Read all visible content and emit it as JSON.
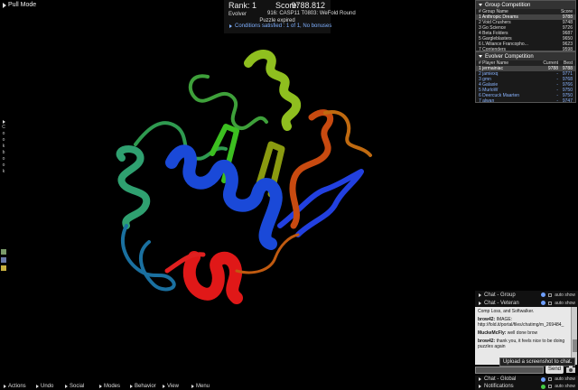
{
  "pull_mode": {
    "label": "Pull Mode"
  },
  "score_panel": {
    "rank": "Rank: 1",
    "score_label": "Score:",
    "score_value": "9788.812",
    "player": "Evolver",
    "puzzle": "916: CASP11 T0803: WeFold Round",
    "status": "Puzzle expired",
    "conditions": "Conditions satisfied : 1 of 1, No bonuses"
  },
  "cookbook": {
    "letters": [
      "C",
      "o",
      "o",
      "k",
      "b",
      "o",
      "o",
      "k"
    ]
  },
  "group_competition": {
    "title": "Group Competition",
    "col_name": "# Group Name",
    "col_score": "Score",
    "rows": [
      {
        "name": "1 Anthropic Dreams",
        "score": "9788",
        "highlight": true
      },
      {
        "name": "2 Void Crushers",
        "score": "9748"
      },
      {
        "name": "3 Go Science",
        "score": "9726"
      },
      {
        "name": "4 Beta Folders",
        "score": "9687"
      },
      {
        "name": "5 Gargleblasters",
        "score": "9650"
      },
      {
        "name": "6 L'Alliance Francopho...",
        "score": "9623"
      },
      {
        "name": "7 Contenders",
        "score": "9598"
      }
    ]
  },
  "evolver_competition": {
    "title": "Evolver Competition",
    "col_name": "# Player Name",
    "col_current": "Current",
    "col_best": "Best",
    "rows": [
      {
        "name": "1 jermainiac",
        "current": "9788",
        "best": "9788",
        "highlight": true
      },
      {
        "name": "2 jamiexq",
        "current": "-",
        "best": "9771",
        "blue": true
      },
      {
        "name": "3 gmn",
        "current": "-",
        "best": "9768",
        "blue": true
      },
      {
        "name": "4 Galaxie",
        "current": "-",
        "best": "9766",
        "blue": true
      },
      {
        "name": "5 MurloW",
        "current": "-",
        "best": "9750",
        "blue": true
      },
      {
        "name": "6 Deercuck Maarten",
        "current": "-",
        "best": "9750",
        "blue": true
      },
      {
        "name": "7 alwan",
        "current": "-",
        "best": "9747",
        "blue": true
      }
    ]
  },
  "chat": {
    "tab_group": "Chat - Group",
    "tab_veteran": "Chat - Veteran",
    "auto_show": "auto show",
    "messages": [
      {
        "who": "",
        "text": "Comp Loss, and Softwalker."
      },
      {
        "who": "brow42:",
        "text": "IMAGE: http://fold.it/portal/files/chatimg/m_269484_"
      },
      {
        "who": "MuckeMcFly:",
        "text": "well done brow"
      },
      {
        "who": "brow42:",
        "text": "thank you, it feels nice to be doing puzzles again"
      }
    ],
    "tooltip": "Upload a screenshot to chat.",
    "send": "Send",
    "tab_global": "Chat - Global",
    "tab_notifications": "Notifications"
  },
  "menu": [
    "Actions",
    "Undo",
    "Social",
    "Modes",
    "Behavior",
    "View",
    "Menu"
  ],
  "colors": {
    "panel_bg": "#1a1a1a",
    "highlight": "#444444",
    "link_blue": "#8ab4ff"
  }
}
